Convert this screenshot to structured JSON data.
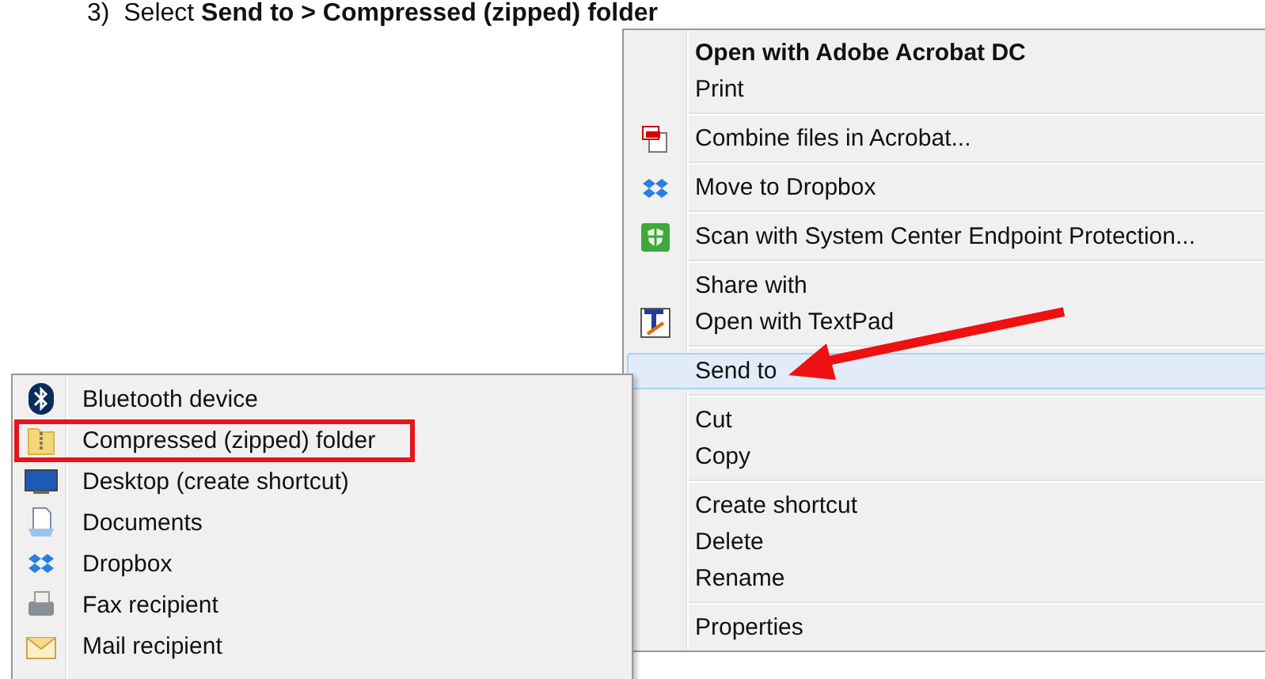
{
  "instruction": {
    "text": "3)  Select **Send to > Compressed (zipped) folder**"
  },
  "context_menu": {
    "sections": [
      {
        "items": [
          {
            "label": "Open with Adobe Acrobat DC",
            "default": true,
            "selected": false,
            "pointed_at": false
          },
          {
            "label": "Print",
            "default": false,
            "selected": false,
            "pointed_at": false
          }
        ]
      },
      {
        "items": [
          {
            "label": "Combine files in Acrobat...",
            "default": false,
            "selected": false,
            "pointed_at": false
          }
        ]
      },
      {
        "items": [
          {
            "label": "Move to Dropbox",
            "default": false,
            "selected": false,
            "pointed_at": false
          }
        ]
      },
      {
        "items": [
          {
            "label": "Scan with System Center Endpoint Protection...",
            "default": false,
            "selected": false,
            "pointed_at": false
          }
        ]
      },
      {
        "items": [
          {
            "label": "Share with",
            "default": false,
            "selected": false,
            "pointed_at": false
          },
          {
            "label": "Open with TextPad",
            "default": false,
            "selected": false,
            "pointed_at": false
          }
        ]
      },
      {
        "items": [
          {
            "label": "Send to",
            "default": false,
            "selected": true,
            "pointed_at": true
          }
        ]
      },
      {
        "items": [
          {
            "label": "Cut",
            "default": false,
            "selected": false,
            "pointed_at": false
          },
          {
            "label": "Copy",
            "default": false,
            "selected": false,
            "pointed_at": false
          }
        ]
      },
      {
        "items": [
          {
            "label": "Create shortcut",
            "default": false,
            "selected": false,
            "pointed_at": false
          },
          {
            "label": "Delete",
            "default": false,
            "selected": false,
            "pointed_at": false
          },
          {
            "label": "Rename",
            "default": false,
            "selected": false,
            "pointed_at": false
          }
        ]
      },
      {
        "items": [
          {
            "label": "Properties",
            "default": false,
            "selected": false,
            "pointed_at": false
          }
        ]
      }
    ]
  },
  "send_to_submenu": {
    "items": [
      {
        "label": "Bluetooth device",
        "outlined": false
      },
      {
        "label": "Compressed (zipped) folder",
        "outlined": true
      },
      {
        "label": "Desktop (create shortcut)",
        "outlined": false
      },
      {
        "label": "Documents",
        "outlined": false
      },
      {
        "label": "Dropbox",
        "outlined": false
      },
      {
        "label": "Fax recipient",
        "outlined": false
      },
      {
        "label": "Mail recipient",
        "outlined": false
      }
    ]
  }
}
